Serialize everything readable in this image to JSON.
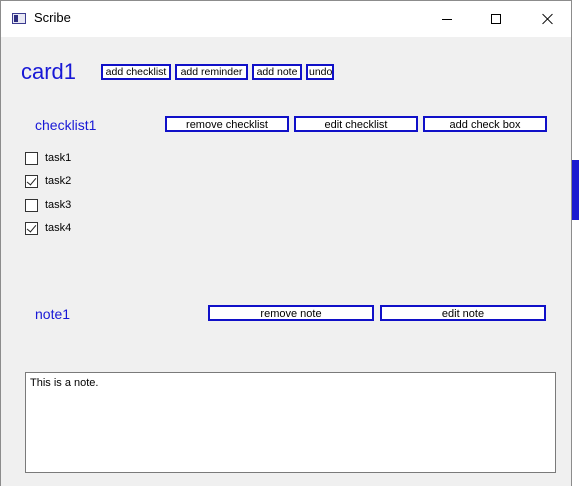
{
  "window": {
    "title": "Scribe"
  },
  "card": {
    "title": "card1",
    "buttons": {
      "add_checklist": "add checklist",
      "add_reminder": "add reminder",
      "add_note": "add note",
      "undo": "undo"
    }
  },
  "checklist": {
    "title": "checklist1",
    "buttons": {
      "remove": "remove checklist",
      "edit": "edit checklist",
      "add_check_box": "add check box"
    },
    "tasks": [
      {
        "label": "task1",
        "checked": false
      },
      {
        "label": "task2",
        "checked": true
      },
      {
        "label": "task3",
        "checked": false
      },
      {
        "label": "task4",
        "checked": true
      }
    ]
  },
  "note": {
    "title": "note1",
    "buttons": {
      "remove": "remove note",
      "edit": "edit note"
    },
    "text": "This is a note."
  },
  "colors": {
    "accent": "#1818d6",
    "button_border": "#1010c8"
  }
}
